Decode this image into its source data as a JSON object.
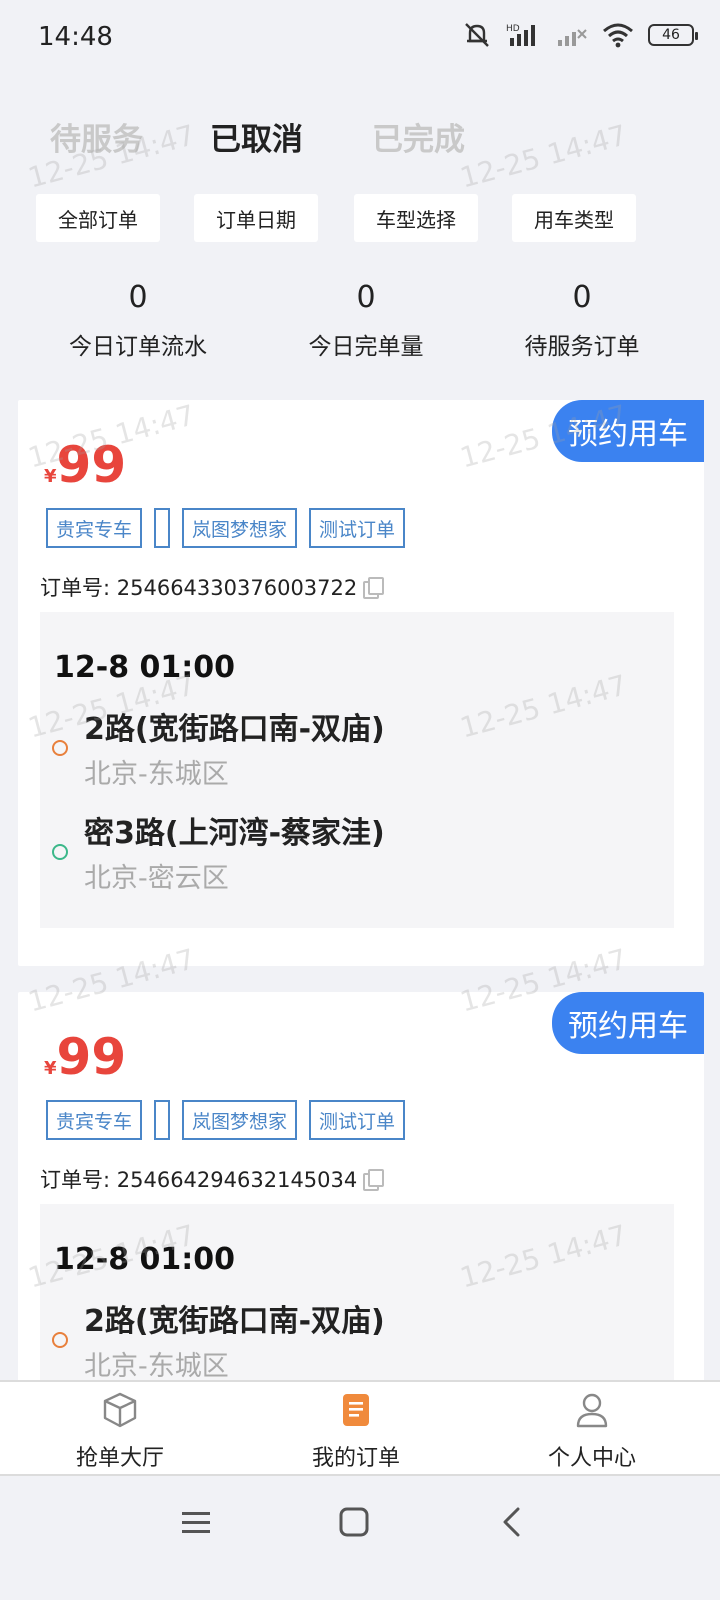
{
  "status_bar": {
    "time": "14:48",
    "battery": "46",
    "hd_label": "HD"
  },
  "tabs": [
    {
      "label": "待服务"
    },
    {
      "label": "已取消"
    },
    {
      "label": "已完成"
    }
  ],
  "filters": [
    {
      "label": "全部订单"
    },
    {
      "label": "订单日期"
    },
    {
      "label": "车型选择"
    },
    {
      "label": "用车类型"
    }
  ],
  "stats": [
    {
      "value": "0",
      "label": "今日订单流水"
    },
    {
      "value": "0",
      "label": "今日完单量"
    },
    {
      "value": "0",
      "label": "待服务订单"
    }
  ],
  "watermark": "12-25 14:47",
  "orders": [
    {
      "badge": "预约用车",
      "currency": "¥",
      "price": "99",
      "tags": [
        "贵宾专车",
        "",
        "岚图梦想家",
        "测试订单"
      ],
      "order_no": "订单号: 254664330376003722",
      "time": "12-8 01:00",
      "start_name": "2路(宽街路口南-双庙)",
      "start_area": "北京-东城区",
      "end_name": "密3路(上河湾-蔡家洼)",
      "end_area": "北京-密云区"
    },
    {
      "badge": "预约用车",
      "currency": "¥",
      "price": "99",
      "tags": [
        "贵宾专车",
        "",
        "岚图梦想家",
        "测试订单"
      ],
      "order_no": "订单号: 254664294632145034",
      "time": "12-8 01:00",
      "start_name": "2路(宽街路口南-双庙)",
      "start_area": "北京-东城区"
    }
  ],
  "bottom_nav": [
    {
      "label": "抢单大厅",
      "icon": "box-icon"
    },
    {
      "label": "我的订单",
      "icon": "document-icon"
    },
    {
      "label": "个人中心",
      "icon": "person-icon"
    }
  ],
  "colors": {
    "accent": "#3b82f0",
    "price": "#e8453c",
    "tag": "#4a86c8",
    "start_dot": "#e8803c",
    "end_dot": "#3cb88a",
    "active_nav": "#f08a3c"
  }
}
